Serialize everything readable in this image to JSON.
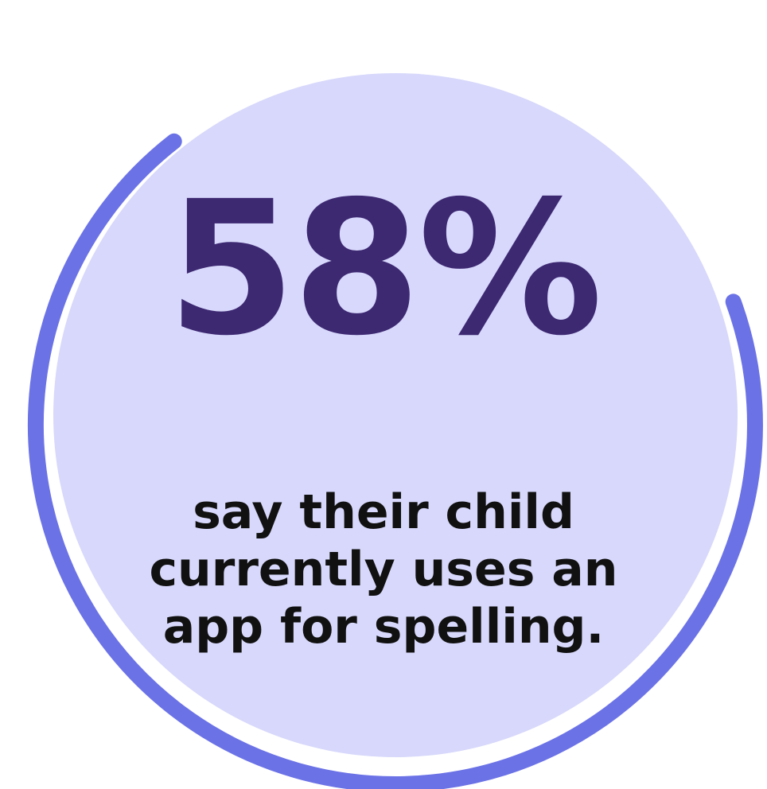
{
  "stat": {
    "value": "58%",
    "caption_lines": [
      "say their child",
      "currently uses an",
      "app for spelling."
    ],
    "progress_fraction": 0.58
  },
  "colors": {
    "circle_fill": "#d7d8fb",
    "ring_stroke": "#6b72e6",
    "value_text": "#3d2872",
    "caption_text": "#111111",
    "background": "#ffffff"
  }
}
